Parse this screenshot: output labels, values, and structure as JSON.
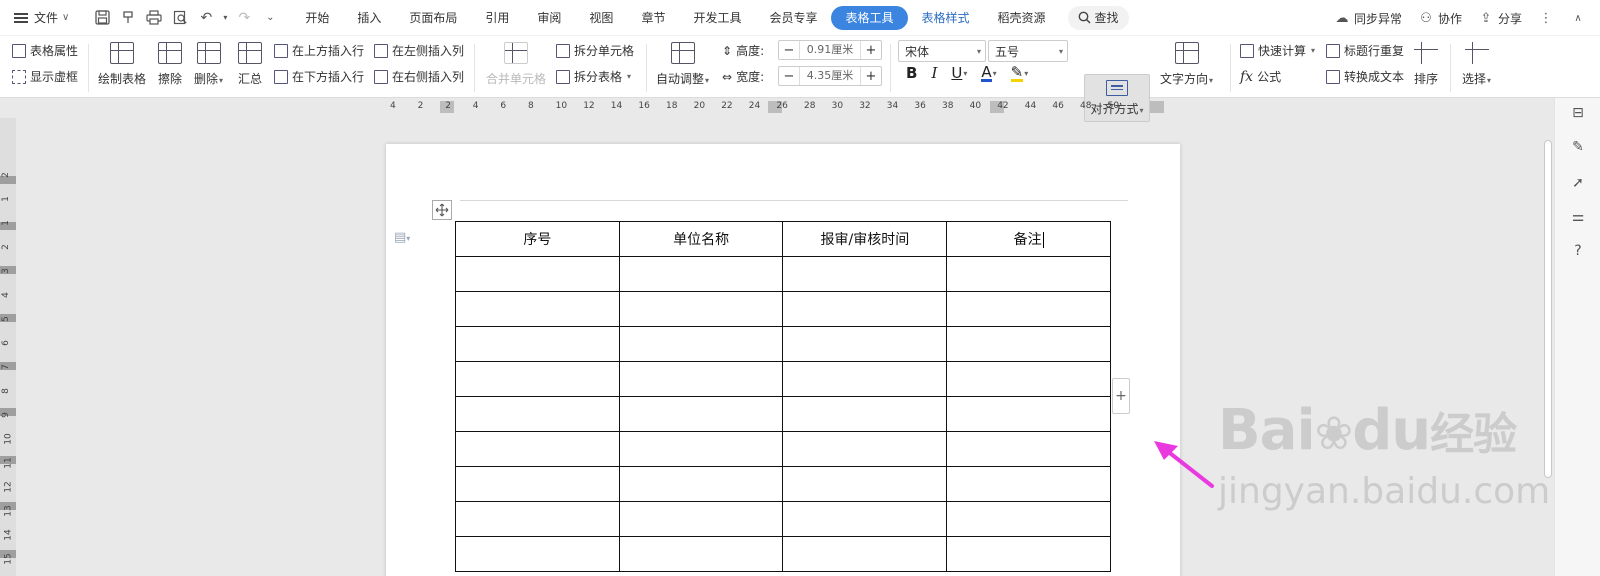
{
  "menu": {
    "file_label": "文件",
    "tabs": [
      {
        "label": "开始",
        "state": "normal"
      },
      {
        "label": "插入",
        "state": "normal"
      },
      {
        "label": "页面布局",
        "state": "normal"
      },
      {
        "label": "引用",
        "state": "normal"
      },
      {
        "label": "审阅",
        "state": "normal"
      },
      {
        "label": "视图",
        "state": "normal"
      },
      {
        "label": "章节",
        "state": "normal"
      },
      {
        "label": "开发工具",
        "state": "normal"
      },
      {
        "label": "会员专享",
        "state": "normal"
      },
      {
        "label": "表格工具",
        "state": "active"
      },
      {
        "label": "表格样式",
        "state": "blue"
      },
      {
        "label": "稻壳资源",
        "state": "normal"
      }
    ],
    "search_label": "查找",
    "sync_label": "同步异常",
    "collab_label": "协作",
    "share_label": "分享"
  },
  "ribbon": {
    "table_props": "表格属性",
    "show_gridlines": "显示虚框",
    "draw_table": "绘制表格",
    "erase": "擦除",
    "delete": "删除",
    "summary": "汇总",
    "insert_above": "在上方插入行",
    "insert_below": "在下方插入行",
    "insert_left": "在左侧插入列",
    "insert_right": "在右侧插入列",
    "merge_cells": "合并单元格",
    "split_cells": "拆分单元格",
    "split_table": "拆分表格",
    "auto_fit": "自动调整",
    "height_label": "高度:",
    "height_value": "0.91厘米",
    "width_label": "宽度:",
    "width_value": "4.35厘米",
    "font_name": "宋体",
    "font_size": "五号",
    "align": "对齐方式",
    "text_direction": "文字方向",
    "quick_calc": "快速计算",
    "repeat_header": "标题行重复",
    "formula": "公式",
    "convert_text": "转换成文本",
    "sort": "排序",
    "select": "选择"
  },
  "ruler": {
    "h_labels": [
      "4",
      "2",
      "2",
      "4",
      "6",
      "8",
      "10",
      "12",
      "14",
      "16",
      "18",
      "20",
      "22",
      "24",
      "26",
      "28",
      "30",
      "32",
      "34",
      "36",
      "38",
      "40",
      "42",
      "44",
      "46",
      "48",
      "50"
    ],
    "v_labels": [
      "2",
      "1",
      "1",
      "2",
      "3",
      "4",
      "5",
      "6",
      "7",
      "8",
      "9",
      "10",
      "11",
      "12",
      "13",
      "14",
      "15"
    ]
  },
  "table": {
    "headers": [
      "序号",
      "单位名称",
      "报审/审核时间",
      "备注"
    ],
    "empty_rows": 9
  },
  "watermark": {
    "logo": "Bai",
    "logo_suffix": "du",
    "cn": "经验",
    "url": "jingyan.baidu.com"
  },
  "colors": {
    "accent": "#3b85e0",
    "arrow": "#e93ae0"
  }
}
